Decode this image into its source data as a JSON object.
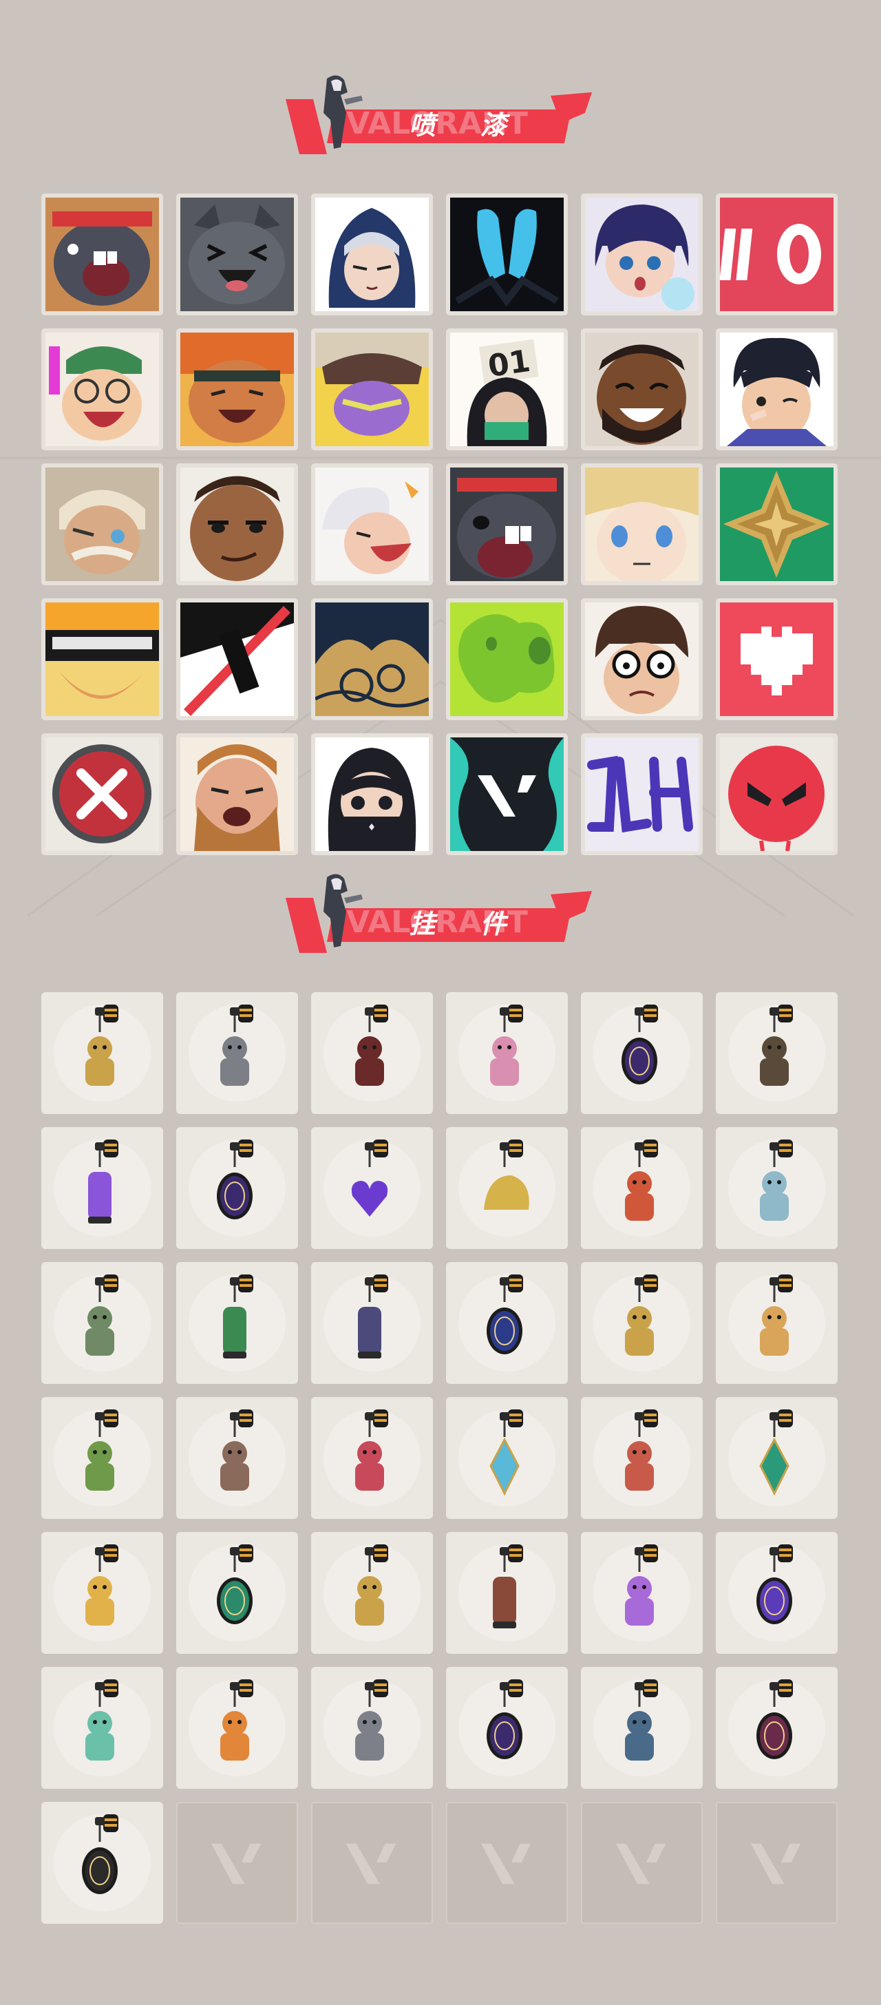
{
  "sections": {
    "sprays": {
      "title": "喷 漆",
      "watermark": "VALORANT",
      "items": [
        "spray-bruiser-shout",
        "spray-cat-laugh",
        "spray-hooded-agent",
        "spray-dark-mask",
        "spray-girl-surprised",
        "spray-number-10",
        "spray-goggles-shout",
        "spray-bear-laugh",
        "spray-hat-yellow",
        "spray-number-01",
        "spray-beard-laugh",
        "spray-boy-wink",
        "spray-old-man-squint",
        "spray-smirk-face",
        "spray-white-hair-shout",
        "spray-bruiser-yell",
        "spray-blonde-face",
        "spray-green-gem",
        "spray-duck-helmet",
        "spray-slash-can",
        "spray-wave-pattern",
        "spray-green-slime",
        "spray-glasses-face",
        "spray-pixel-heart",
        "spray-red-x",
        "spray-beard-eat",
        "spray-masked-girl",
        "spray-valorant-splash",
        "spray-purple-graffiti",
        "spray-red-mask"
      ]
    },
    "charms": {
      "title": "挂 件",
      "watermark": "VALORANT",
      "items": [
        "charm-gold-robot",
        "charm-grill",
        "charm-rope-whip",
        "charm-cupcake",
        "charm-ep9-medallion",
        "charm-mechanism",
        "charm-lava-lamp",
        "charm-ep9-medallion-purple",
        "charm-purple-heart",
        "charm-taco",
        "charm-skewer",
        "charm-agent-card",
        "charm-robot-kiosk",
        "charm-green-can",
        "charm-lantern",
        "charm-ep9-medallion-blue",
        "charm-gold-figure",
        "charm-cat-doll",
        "charm-green-mask",
        "charm-raccoon",
        "charm-mecha-hero",
        "charm-blue-blade",
        "charm-octopus",
        "charm-green-diamond",
        "charm-sun-cloud",
        "charm-ep8-medallion-green",
        "charm-pretzel",
        "charm-bottle",
        "charm-flame-lotus",
        "charm-ep8-medallion-purple",
        "charm-ufo",
        "charm-fire-cat",
        "charm-gray-cat",
        "charm-ep7-medallion",
        "charm-tassel",
        "charm-ep7-medallion-red",
        "charm-v-medallion"
      ],
      "empty_slots": 5
    }
  },
  "colors": {
    "background": "#cbc4be",
    "banner_red": "#ee3c4b",
    "tile_bg": "#ece8e2",
    "empty_tile": "#c4bcb5"
  }
}
